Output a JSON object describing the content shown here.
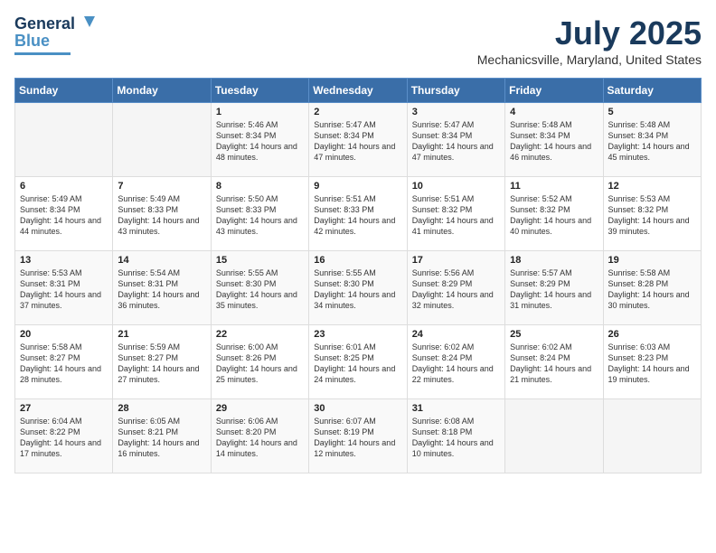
{
  "header": {
    "logo_general": "General",
    "logo_blue": "Blue",
    "title": "July 2025",
    "subtitle": "Mechanicsville, Maryland, United States"
  },
  "days_of_week": [
    "Sunday",
    "Monday",
    "Tuesday",
    "Wednesday",
    "Thursday",
    "Friday",
    "Saturday"
  ],
  "weeks": [
    [
      {
        "day": "",
        "sunrise": "",
        "sunset": "",
        "daylight": ""
      },
      {
        "day": "",
        "sunrise": "",
        "sunset": "",
        "daylight": ""
      },
      {
        "day": "1",
        "sunrise": "Sunrise: 5:46 AM",
        "sunset": "Sunset: 8:34 PM",
        "daylight": "Daylight: 14 hours and 48 minutes."
      },
      {
        "day": "2",
        "sunrise": "Sunrise: 5:47 AM",
        "sunset": "Sunset: 8:34 PM",
        "daylight": "Daylight: 14 hours and 47 minutes."
      },
      {
        "day": "3",
        "sunrise": "Sunrise: 5:47 AM",
        "sunset": "Sunset: 8:34 PM",
        "daylight": "Daylight: 14 hours and 47 minutes."
      },
      {
        "day": "4",
        "sunrise": "Sunrise: 5:48 AM",
        "sunset": "Sunset: 8:34 PM",
        "daylight": "Daylight: 14 hours and 46 minutes."
      },
      {
        "day": "5",
        "sunrise": "Sunrise: 5:48 AM",
        "sunset": "Sunset: 8:34 PM",
        "daylight": "Daylight: 14 hours and 45 minutes."
      }
    ],
    [
      {
        "day": "6",
        "sunrise": "Sunrise: 5:49 AM",
        "sunset": "Sunset: 8:34 PM",
        "daylight": "Daylight: 14 hours and 44 minutes."
      },
      {
        "day": "7",
        "sunrise": "Sunrise: 5:49 AM",
        "sunset": "Sunset: 8:33 PM",
        "daylight": "Daylight: 14 hours and 43 minutes."
      },
      {
        "day": "8",
        "sunrise": "Sunrise: 5:50 AM",
        "sunset": "Sunset: 8:33 PM",
        "daylight": "Daylight: 14 hours and 43 minutes."
      },
      {
        "day": "9",
        "sunrise": "Sunrise: 5:51 AM",
        "sunset": "Sunset: 8:33 PM",
        "daylight": "Daylight: 14 hours and 42 minutes."
      },
      {
        "day": "10",
        "sunrise": "Sunrise: 5:51 AM",
        "sunset": "Sunset: 8:32 PM",
        "daylight": "Daylight: 14 hours and 41 minutes."
      },
      {
        "day": "11",
        "sunrise": "Sunrise: 5:52 AM",
        "sunset": "Sunset: 8:32 PM",
        "daylight": "Daylight: 14 hours and 40 minutes."
      },
      {
        "day": "12",
        "sunrise": "Sunrise: 5:53 AM",
        "sunset": "Sunset: 8:32 PM",
        "daylight": "Daylight: 14 hours and 39 minutes."
      }
    ],
    [
      {
        "day": "13",
        "sunrise": "Sunrise: 5:53 AM",
        "sunset": "Sunset: 8:31 PM",
        "daylight": "Daylight: 14 hours and 37 minutes."
      },
      {
        "day": "14",
        "sunrise": "Sunrise: 5:54 AM",
        "sunset": "Sunset: 8:31 PM",
        "daylight": "Daylight: 14 hours and 36 minutes."
      },
      {
        "day": "15",
        "sunrise": "Sunrise: 5:55 AM",
        "sunset": "Sunset: 8:30 PM",
        "daylight": "Daylight: 14 hours and 35 minutes."
      },
      {
        "day": "16",
        "sunrise": "Sunrise: 5:55 AM",
        "sunset": "Sunset: 8:30 PM",
        "daylight": "Daylight: 14 hours and 34 minutes."
      },
      {
        "day": "17",
        "sunrise": "Sunrise: 5:56 AM",
        "sunset": "Sunset: 8:29 PM",
        "daylight": "Daylight: 14 hours and 32 minutes."
      },
      {
        "day": "18",
        "sunrise": "Sunrise: 5:57 AM",
        "sunset": "Sunset: 8:29 PM",
        "daylight": "Daylight: 14 hours and 31 minutes."
      },
      {
        "day": "19",
        "sunrise": "Sunrise: 5:58 AM",
        "sunset": "Sunset: 8:28 PM",
        "daylight": "Daylight: 14 hours and 30 minutes."
      }
    ],
    [
      {
        "day": "20",
        "sunrise": "Sunrise: 5:58 AM",
        "sunset": "Sunset: 8:27 PM",
        "daylight": "Daylight: 14 hours and 28 minutes."
      },
      {
        "day": "21",
        "sunrise": "Sunrise: 5:59 AM",
        "sunset": "Sunset: 8:27 PM",
        "daylight": "Daylight: 14 hours and 27 minutes."
      },
      {
        "day": "22",
        "sunrise": "Sunrise: 6:00 AM",
        "sunset": "Sunset: 8:26 PM",
        "daylight": "Daylight: 14 hours and 25 minutes."
      },
      {
        "day": "23",
        "sunrise": "Sunrise: 6:01 AM",
        "sunset": "Sunset: 8:25 PM",
        "daylight": "Daylight: 14 hours and 24 minutes."
      },
      {
        "day": "24",
        "sunrise": "Sunrise: 6:02 AM",
        "sunset": "Sunset: 8:24 PM",
        "daylight": "Daylight: 14 hours and 22 minutes."
      },
      {
        "day": "25",
        "sunrise": "Sunrise: 6:02 AM",
        "sunset": "Sunset: 8:24 PM",
        "daylight": "Daylight: 14 hours and 21 minutes."
      },
      {
        "day": "26",
        "sunrise": "Sunrise: 6:03 AM",
        "sunset": "Sunset: 8:23 PM",
        "daylight": "Daylight: 14 hours and 19 minutes."
      }
    ],
    [
      {
        "day": "27",
        "sunrise": "Sunrise: 6:04 AM",
        "sunset": "Sunset: 8:22 PM",
        "daylight": "Daylight: 14 hours and 17 minutes."
      },
      {
        "day": "28",
        "sunrise": "Sunrise: 6:05 AM",
        "sunset": "Sunset: 8:21 PM",
        "daylight": "Daylight: 14 hours and 16 minutes."
      },
      {
        "day": "29",
        "sunrise": "Sunrise: 6:06 AM",
        "sunset": "Sunset: 8:20 PM",
        "daylight": "Daylight: 14 hours and 14 minutes."
      },
      {
        "day": "30",
        "sunrise": "Sunrise: 6:07 AM",
        "sunset": "Sunset: 8:19 PM",
        "daylight": "Daylight: 14 hours and 12 minutes."
      },
      {
        "day": "31",
        "sunrise": "Sunrise: 6:08 AM",
        "sunset": "Sunset: 8:18 PM",
        "daylight": "Daylight: 14 hours and 10 minutes."
      },
      {
        "day": "",
        "sunrise": "",
        "sunset": "",
        "daylight": ""
      },
      {
        "day": "",
        "sunrise": "",
        "sunset": "",
        "daylight": ""
      }
    ]
  ]
}
